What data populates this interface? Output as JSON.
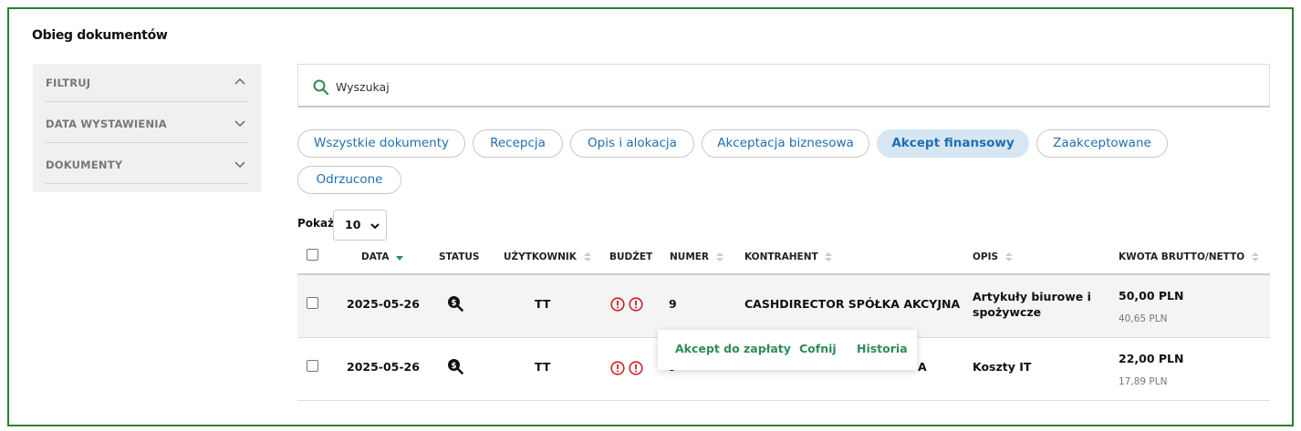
{
  "page_title": "Obieg dokumentów",
  "sidebar": {
    "items": [
      {
        "label": "FILTRUJ",
        "state": "expanded"
      },
      {
        "label": "DATA WYSTAWIENIA",
        "state": "collapsed"
      },
      {
        "label": "DOKUMENTY",
        "state": "collapsed"
      }
    ]
  },
  "search": {
    "placeholder": "Wyszukaj"
  },
  "tabs": [
    {
      "label": "Wszystkie dokumenty",
      "active": false
    },
    {
      "label": "Recepcja",
      "active": false
    },
    {
      "label": "Opis i alokacja",
      "active": false
    },
    {
      "label": "Akceptacja biznesowa",
      "active": false
    },
    {
      "label": "Akcept finansowy",
      "active": true
    },
    {
      "label": "Zaakceptowane",
      "active": false
    },
    {
      "label": "Odrzucone",
      "active": false
    }
  ],
  "show": {
    "label": "Pokaż",
    "value": "10"
  },
  "table": {
    "headers": {
      "data": "DATA",
      "status": "STATUS",
      "uzytkownik": "UŻYTKOWNIK",
      "budzet": "BUDŻET",
      "numer": "NUMER",
      "kontrahent": "KONTRAHENT",
      "opis": "OPIS",
      "kwota": "KWOTA BRUTTO/NETTO"
    },
    "rows": [
      {
        "data": "2025-05-26",
        "status_icon": "search-dollar-icon",
        "uzytkownik": "TT",
        "budzet_icons": [
          "alert-circle-icon",
          "alert-circle-icon"
        ],
        "numer": "9",
        "kontrahent": "CASHDIRECTOR SPÓŁKA AKCYJNA",
        "opis_line1": "Artykuły biurowe i",
        "opis_line2": "spożywcze",
        "brutto": "50,00  PLN",
        "netto": "40,65 PLN"
      },
      {
        "data": "2025-05-26",
        "status_icon": "search-dollar-icon",
        "uzytkownik": "TT",
        "budzet_icons": [
          "alert-circle-icon",
          "alert-circle-icon"
        ],
        "numer_partial": "9",
        "kontrahent_partial": "A",
        "opis": "Koszty IT",
        "brutto": "22,00  PLN",
        "netto": "17,89 PLN"
      }
    ]
  },
  "row_actions": {
    "accept_label": "Akcept do zapłaty",
    "undo_label": "Cofnij",
    "history_label": "Historia"
  },
  "colors": {
    "frame_border": "#2e7d32",
    "accent_green": "#2e8b57",
    "pill_text": "#1f6fb2",
    "pill_active_bg": "#d6e6f3",
    "alert_red": "#cc2222"
  }
}
